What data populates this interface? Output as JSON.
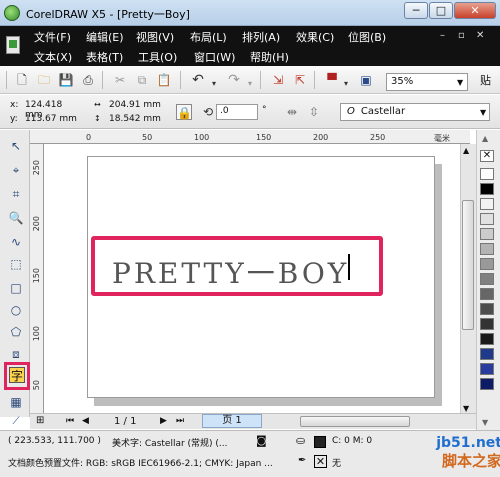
{
  "window": {
    "title": "CorelDRAW X5 - [Pretty一Boy]",
    "minimize": "─",
    "maximize": "□",
    "close": "✕"
  },
  "menu": {
    "row1": [
      "文件(F)",
      "编辑(E)",
      "视图(V)",
      "布局(L)",
      "排列(A)",
      "效果(C)",
      "位图(B)"
    ],
    "row2": [
      "文本(X)",
      "表格(T)",
      "工具(O)",
      "窗口(W)",
      "帮助(H)"
    ],
    "mdi_buttons": [
      "–",
      "▫",
      "✕"
    ]
  },
  "toolbar": {
    "zoom": "35%",
    "extra": "贴"
  },
  "properties": {
    "x_label": "x:",
    "x": "124.418 mm",
    "y_label": "y:",
    "y": "113.67 mm",
    "w": "204.91 mm",
    "h": "18.542 mm",
    "angle": ".0",
    "angle_unit": "°",
    "font": "Castellar"
  },
  "rulers": {
    "top": [
      "0",
      "50",
      "100",
      "150",
      "200",
      "250"
    ],
    "left": [
      "250",
      "200",
      "150",
      "100",
      "50"
    ],
    "unit": "毫米"
  },
  "document": {
    "text": "PRETTY一BOY"
  },
  "page_nav": {
    "indicator": "1 / 1",
    "tab": "页 1"
  },
  "status": {
    "coords": "( 223.533, 111.700 )",
    "object": "美术字: Castellar (常规) (...",
    "fill": "C: 0 M: 0",
    "profile": "文档颜色预置文件: RGB: sRGB IEC61966-2.1; CMYK: Japan ...",
    "outline": "无"
  },
  "watermark": {
    "line1": "jb51.net",
    "line2": "脚本之家"
  },
  "colors": {
    "highlight": "#e0245e",
    "menubar": "#111111",
    "palette": [
      "#ffffff",
      "#000000",
      "#f2f2f2",
      "#e0e0e0",
      "#cccccc",
      "#b3b3b3",
      "#999999",
      "#808080",
      "#666666",
      "#4d4d4d",
      "#333333",
      "#1a1a1a",
      "#1f3a8a",
      "#2a3b9e",
      "#0d1a66"
    ]
  }
}
